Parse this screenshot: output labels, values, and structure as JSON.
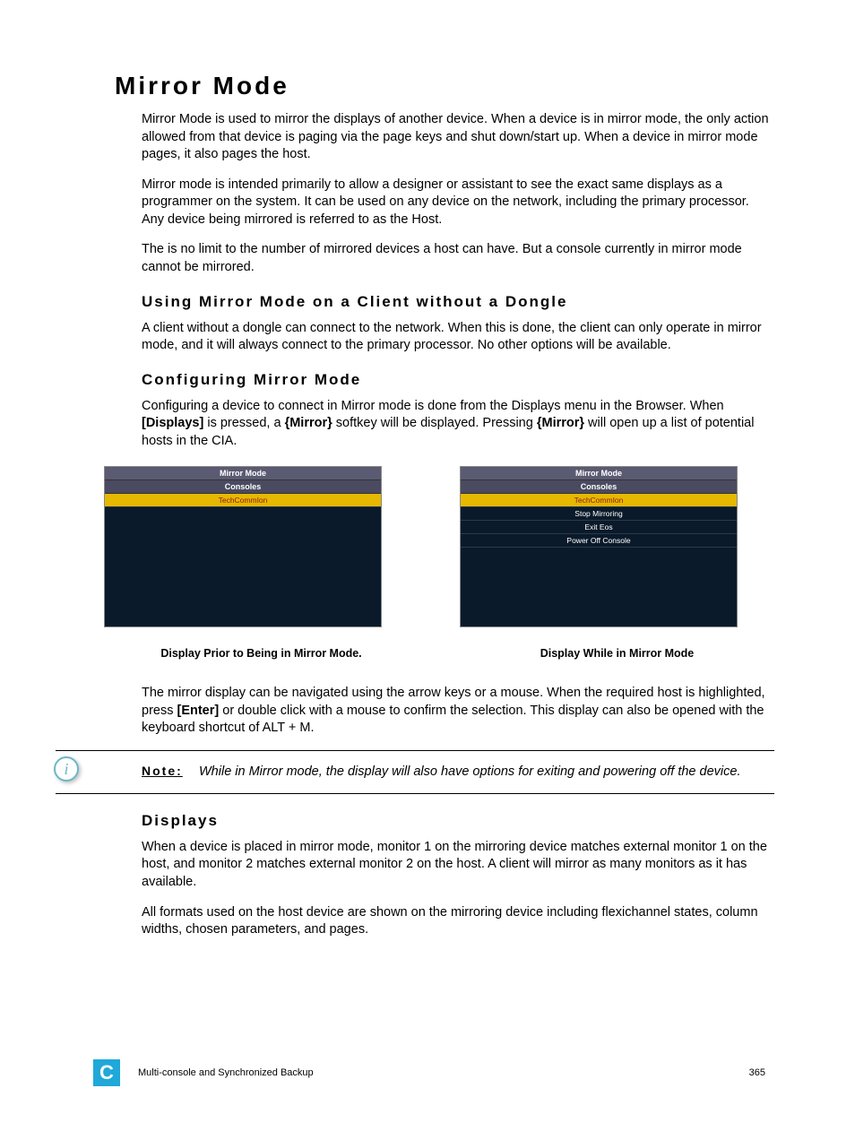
{
  "title": "Mirror Mode",
  "para1": "Mirror Mode is used to mirror the displays of another device. When a device is in mirror mode, the only action allowed from that device is paging via the page keys and shut down/start up. When a device in mirror mode pages, it also pages the host.",
  "para2": "Mirror mode is intended primarily to allow a designer or assistant to see the exact same displays as a programmer on the system. It can be used on any device on the network, including the primary processor. Any device being mirrored is referred to as the Host.",
  "para3": "The is no limit to the number of mirrored devices a host can have. But a console currently in mirror mode cannot be mirrored.",
  "h2a": "Using Mirror Mode on a Client without a Dongle",
  "para4": "A client without a dongle can connect to the network. When this is done, the client can only operate in mirror mode, and it will always connect to the primary processor. No other options will be available.",
  "h2b": "Configuring Mirror Mode",
  "para5_a": "Configuring a device to connect in Mirror mode is done from the Displays menu in the Browser. When ",
  "para5_b": "[Displays]",
  "para5_c": " is pressed, a ",
  "para5_d": "{Mirror}",
  "para5_e": " softkey will be displayed. Pressing ",
  "para5_f": "{Mirror}",
  "para5_g": " will open up a list of potential hosts in the CIA.",
  "panelL": {
    "title": "Mirror Mode",
    "sub": "Consoles",
    "rows": [
      "TechCommIon"
    ]
  },
  "panelR": {
    "title": "Mirror Mode",
    "sub": "Consoles",
    "rows": [
      "TechCommIon",
      "Stop Mirroring",
      "Exit Eos",
      "Power Off Console"
    ]
  },
  "captionL": "Display Prior to Being in Mirror Mode.",
  "captionR": "Display While in Mirror Mode",
  "para6_a": "The mirror display can be navigated using the arrow keys or a mouse. When the required host is highlighted, press ",
  "para6_b": "[Enter]",
  "para6_c": " or double click with a mouse to confirm the selection. This display can also be opened with the keyboard shortcut of ALT + M.",
  "noteLabel": "Note:",
  "noteText": "While in Mirror mode, the display will also have options for exiting and powering off the device.",
  "h3a": "Displays",
  "para7": "When a device is placed in mirror mode, monitor 1 on the mirroring device matches external monitor 1 on the host, and monitor 2 matches external monitor 2 on the host. A client will mirror as many monitors as it has available.",
  "para8": "All formats used on the host device are shown on the mirroring device including flexichannel states, column widths, chosen parameters, and pages.",
  "footerBadge": "C",
  "footerText": "Multi-console and Synchronized Backup",
  "footerPage": "365"
}
